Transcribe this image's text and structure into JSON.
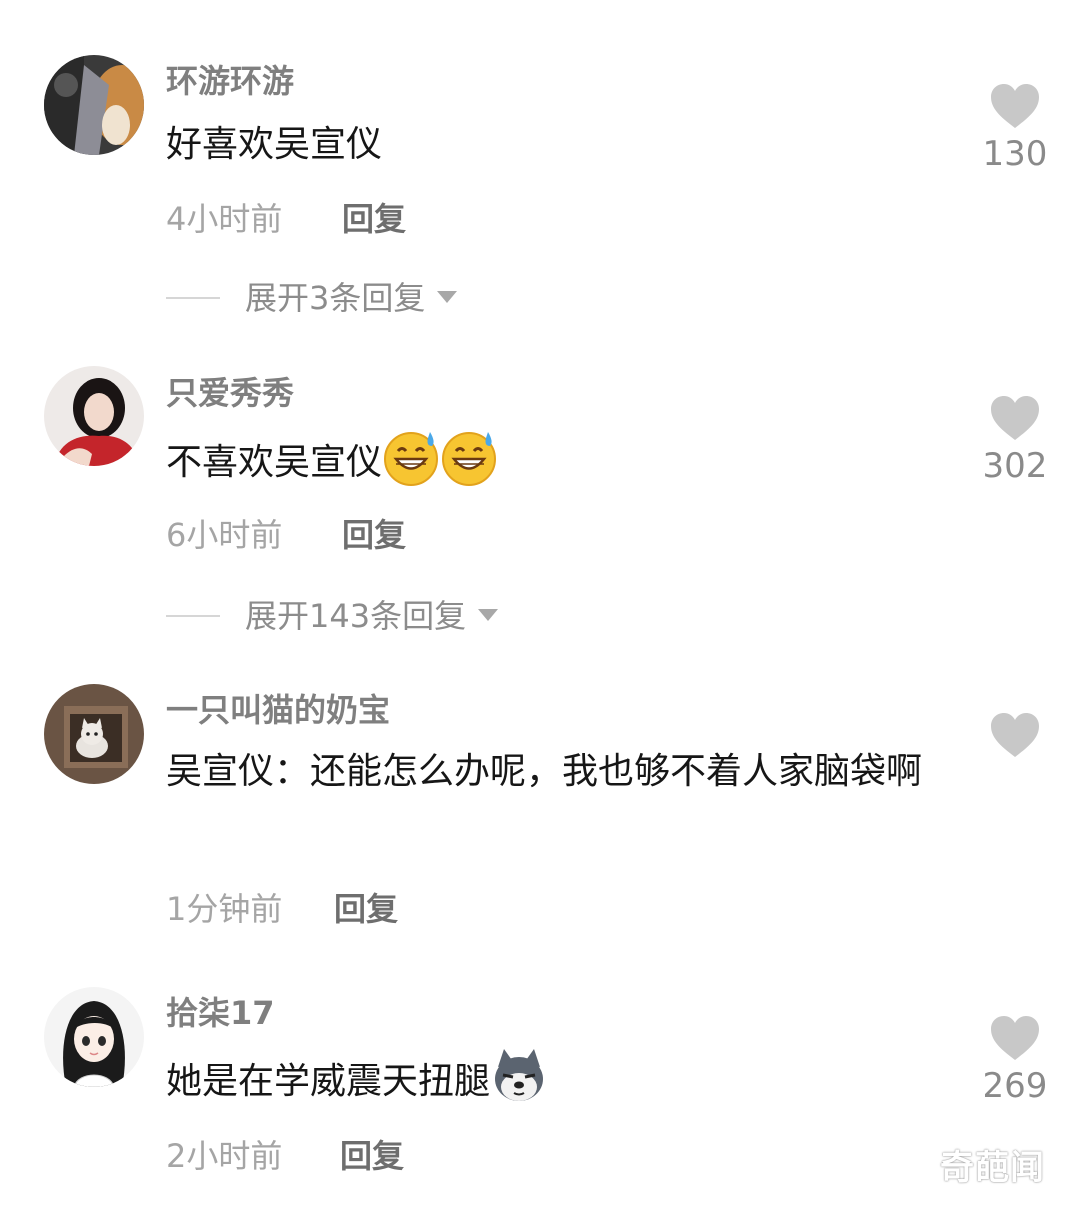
{
  "comments": [
    {
      "username": "环游环游",
      "text": "好喜欢吴宣仪",
      "time": "4小时前",
      "reply_label": "回复",
      "likes": "130",
      "expand_label": "展开3条回复",
      "avatar": "dog-avatar"
    },
    {
      "username": "只爱秀秀",
      "text": "不喜欢吴宣仪",
      "emojis": [
        "grinning-sweat-emoji",
        "grinning-sweat-emoji"
      ],
      "time": "6小时前",
      "reply_label": "回复",
      "likes": "302",
      "expand_label": "展开143条回复",
      "avatar": "girl-red-avatar"
    },
    {
      "username": "一只叫猫的奶宝",
      "text": "吴宣仪：还能怎么办呢，我也够不着人家脑袋啊",
      "time": "1分钟前",
      "reply_label": "回复",
      "avatar": "cat-in-box-avatar"
    },
    {
      "username": "拾柒17",
      "text": "她是在学威震天扭腿",
      "emojis": [
        "doge-emoji"
      ],
      "time": "2小时前",
      "reply_label": "回复",
      "likes": "269",
      "avatar": "anime-girl-avatar"
    }
  ],
  "watermark": "奇葩闻",
  "colors": {
    "background": "#ffffff",
    "username": "#7f7f7f",
    "text": "#161616",
    "meta": "#a5a5a5",
    "like_icon": "#c8c8c8"
  }
}
